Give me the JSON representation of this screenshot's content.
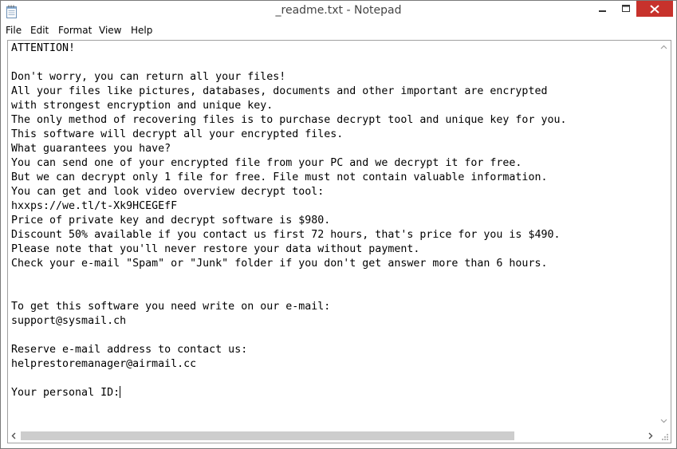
{
  "window": {
    "title": "_readme.txt - Notepad",
    "icon": "notepad-icon"
  },
  "title_buttons": {
    "minimize": "minimize-icon",
    "maximize": "maximize-icon",
    "close": "close-icon"
  },
  "menu": {
    "items": [
      "File",
      "Edit",
      "Format",
      "View",
      "Help"
    ]
  },
  "document": {
    "lines": [
      "ATTENTION!",
      "",
      "Don't worry, you can return all your files!",
      "All your files like pictures, databases, documents and other important are encrypted",
      "with strongest encryption and unique key.",
      "The only method of recovering files is to purchase decrypt tool and unique key for you.",
      "This software will decrypt all your encrypted files.",
      "What guarantees you have?",
      "You can send one of your encrypted file from your PC and we decrypt it for free.",
      "But we can decrypt only 1 file for free. File must not contain valuable information.",
      "You can get and look video overview decrypt tool:",
      "hxxps://we.tl/t-Xk9HCEGEfF",
      "Price of private key and decrypt software is $980.",
      "Discount 50% available if you contact us first 72 hours, that's price for you is $490.",
      "Please note that you'll never restore your data without payment.",
      "Check your e-mail \"Spam\" or \"Junk\" folder if you don't get answer more than 6 hours.",
      "",
      "",
      "To get this software you need write on our e-mail:",
      "support@sysmail.ch",
      "",
      "Reserve e-mail address to contact us:",
      "helprestoremanager@airmail.cc",
      "",
      "Your personal ID:"
    ]
  },
  "colors": {
    "close_button": "#c7322c",
    "scroll_thumb": "#cdcdcd",
    "border": "#a0a0a0"
  }
}
